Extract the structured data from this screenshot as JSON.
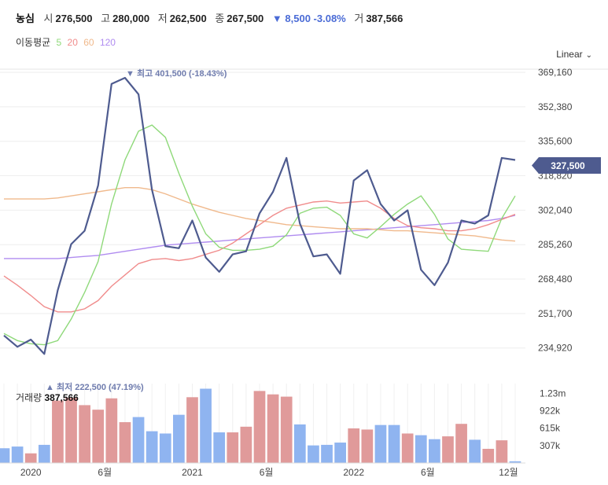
{
  "header": {
    "name": "농심",
    "open_label": "시",
    "open": "276,500",
    "high_label": "고",
    "high": "280,000",
    "low_label": "저",
    "low": "262,500",
    "close_label": "종",
    "close": "267,500",
    "change": "▼ 8,500 -3.08%",
    "volume_label": "거",
    "volume": "387,566"
  },
  "ma_legend": {
    "title": "이동평균",
    "periods": [
      {
        "label": "5",
        "color": "#8fd97a"
      },
      {
        "label": "20",
        "color": "#f08c8c"
      },
      {
        "label": "60",
        "color": "#f0b98c"
      },
      {
        "label": "120",
        "color": "#b08cf0"
      }
    ]
  },
  "scale_button": {
    "label": "Linear",
    "icon": "chevron-down-icon"
  },
  "volume_panel": {
    "label": "거래량",
    "value": "387,566"
  },
  "annotations": {
    "high": "▼ 최고 401,500 (-18.43%)",
    "low": "▲ 최저 222,500 (47.19%)"
  },
  "current_price": "327,500",
  "colors": {
    "price": "#4e5b8f",
    "ma5": "#8fd97a",
    "ma20": "#f08c8c",
    "ma60": "#f0b98c",
    "ma120": "#b08cf0",
    "vol_up": "#e09a9a",
    "vol_down": "#8fb4f0",
    "grid": "#eeeeee"
  },
  "chart_data": {
    "type": "line",
    "y_ticks": [
      "369,160",
      "352,380",
      "335,600",
      "318,820",
      "302,040",
      "285,260",
      "268,480",
      "251,700",
      "234,920"
    ],
    "ylim": [
      226000,
      373000
    ],
    "x_ticks": [
      "2020",
      "6월",
      "2021",
      "6월",
      "2022",
      "6월",
      "12월"
    ],
    "x_tick_index": [
      2,
      7.5,
      14,
      19.5,
      26,
      31.5,
      37.5
    ],
    "price": [
      241000,
      235500,
      239000,
      232000,
      263000,
      285500,
      292000,
      314000,
      363500,
      366500,
      358500,
      312000,
      284500,
      283500,
      297000,
      279000,
      272000,
      280500,
      282000,
      300500,
      311000,
      327500,
      295500,
      279500,
      280500,
      271000,
      316500,
      321500,
      305000,
      297000,
      302000,
      273000,
      265500,
      276500,
      297000,
      295500,
      299500,
      327500,
      326500
    ],
    "ma5": [
      242000,
      238500,
      237000,
      236500,
      238500,
      249000,
      262000,
      277000,
      305000,
      326500,
      340500,
      343500,
      337500,
      320000,
      304000,
      290500,
      284000,
      282500,
      282500,
      283000,
      284500,
      290000,
      300500,
      303000,
      303500,
      299500,
      290500,
      288500,
      294000,
      300000,
      305000,
      309000,
      300000,
      288000,
      283000,
      282500,
      282000,
      298000,
      309000
    ],
    "ma20": [
      270000,
      265500,
      260500,
      255000,
      252500,
      252500,
      254000,
      258000,
      265000,
      270500,
      276000,
      278000,
      278500,
      277500,
      278500,
      280500,
      282500,
      286000,
      290500,
      295000,
      299500,
      303000,
      304500,
      306000,
      306500,
      305500,
      306000,
      306500,
      303000,
      298000,
      294500,
      293500,
      293000,
      292000,
      292000,
      293000,
      295000,
      297500,
      300000
    ],
    "ma60": [
      307500,
      307500,
      307500,
      307500,
      308000,
      309000,
      310000,
      311000,
      312000,
      313000,
      313000,
      312000,
      310000,
      307500,
      305000,
      303000,
      301000,
      299500,
      298000,
      297000,
      296000,
      295000,
      294500,
      294000,
      293500,
      293000,
      293000,
      293000,
      292500,
      292000,
      292000,
      291500,
      291000,
      290500,
      290000,
      289500,
      288500,
      287500,
      287000
    ],
    "ma120": [
      278500,
      278500,
      278500,
      278500,
      278500,
      279000,
      279500,
      280000,
      281000,
      282000,
      283000,
      284000,
      285000,
      285500,
      286000,
      286500,
      287000,
      287500,
      288000,
      288500,
      289000,
      289500,
      290000,
      290500,
      291000,
      291500,
      292000,
      292500,
      293000,
      293500,
      294000,
      294500,
      295000,
      295500,
      296000,
      296500,
      297000,
      298000,
      299500
    ],
    "volume_ticks": [
      "1.23m",
      "922k",
      "615k",
      "307k"
    ],
    "volume_ylim": [
      0,
      1400000
    ],
    "volume": [
      260000,
      290000,
      170000,
      320000,
      1100000,
      1150000,
      1020000,
      940000,
      1140000,
      720000,
      810000,
      560000,
      520000,
      850000,
      1160000,
      1310000,
      540000,
      540000,
      640000,
      1270000,
      1210000,
      1170000,
      680000,
      310000,
      320000,
      360000,
      610000,
      590000,
      670000,
      670000,
      520000,
      490000,
      420000,
      470000,
      690000,
      410000,
      250000,
      400000,
      30000
    ],
    "volume_up": [
      false,
      false,
      true,
      false,
      true,
      true,
      true,
      true,
      true,
      true,
      false,
      false,
      false,
      false,
      true,
      false,
      false,
      true,
      true,
      true,
      true,
      true,
      false,
      false,
      false,
      false,
      true,
      true,
      false,
      false,
      true,
      false,
      false,
      true,
      true,
      false,
      true,
      true,
      false
    ]
  }
}
